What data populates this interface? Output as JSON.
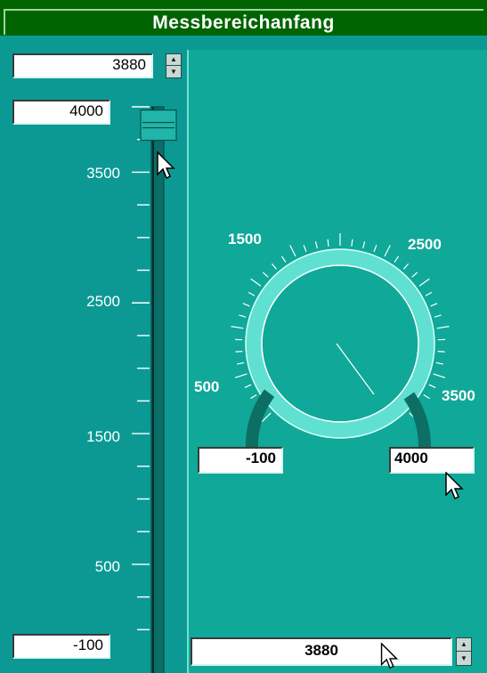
{
  "window": {
    "title": "Messbereichanfang"
  },
  "left": {
    "top_spin_value": "3880",
    "slider_max_value": "4000",
    "slider_min_value": "-100",
    "scale_labels": [
      "3500",
      "2500",
      "1500",
      "500"
    ]
  },
  "right": {
    "dial_labels": [
      "1500",
      "2500",
      "500",
      "3500"
    ],
    "range_min_value": "-100",
    "range_max_value": "4000",
    "bottom_spin_value": "3880"
  },
  "controls": {
    "vertical_slider_value": 3880,
    "vertical_slider_min": -100,
    "vertical_slider_max": 4000,
    "dial_value": 3880,
    "dial_min": -100,
    "dial_max": 4000
  },
  "colors": {
    "title_bar": "#006400",
    "panel": "#0c9994",
    "dial_ring": "#60e0d0",
    "dial_arc": "#0d6e63"
  },
  "icons": [
    "spin-up-arrow-icon",
    "spin-down-arrow-icon",
    "mouse-pointer-icon"
  ]
}
